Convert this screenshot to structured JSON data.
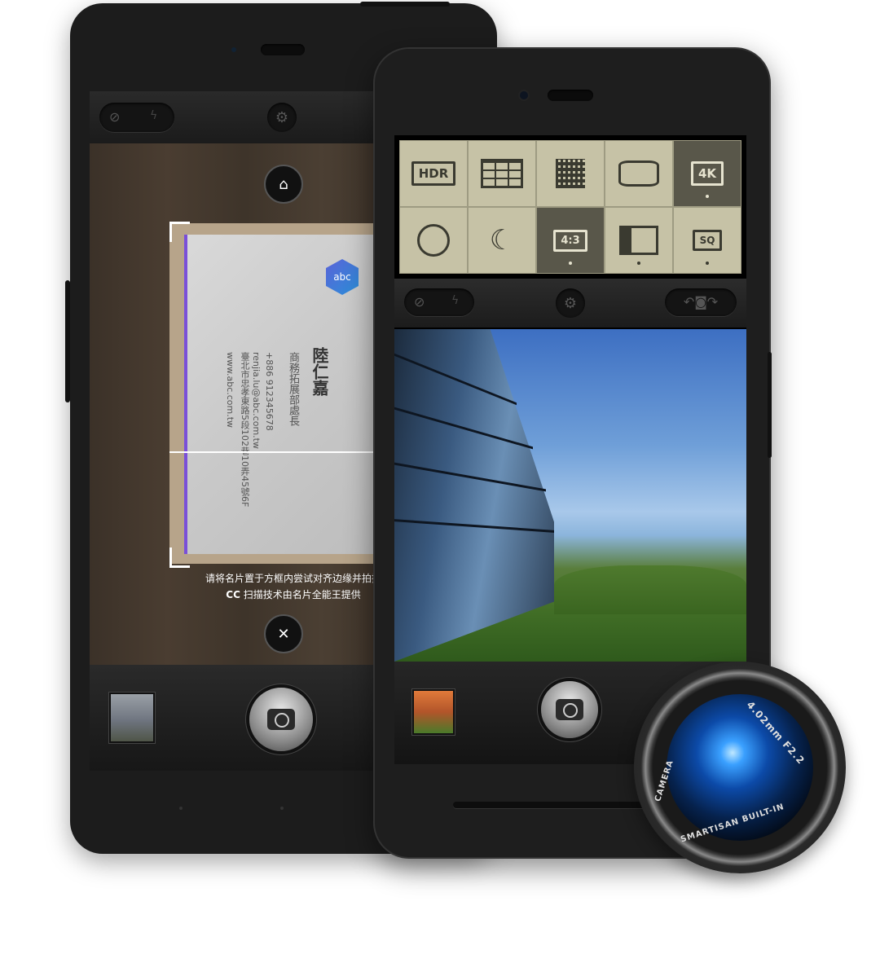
{
  "back_phone": {
    "flash_icon": "flashlight-icon",
    "toolbar": {
      "flash_toggle_icon": "flash-off-icon",
      "settings_icon": "gear-icon"
    },
    "card": {
      "logo_text": "abc",
      "name": "陸仁嘉",
      "title": "商務拓展部處長",
      "phone": "+886 912345678",
      "email": "renjia.lu@abc.com.tw",
      "address": "臺北市忠孝東路5段102巷10弄45號6F",
      "website": "www.abc.com.tw"
    },
    "hint_line1": "请将名片置于方框内尝试对齐边缘并拍摄",
    "hint_line2": "扫描技术由名片全能王提供",
    "hint_logo": "CC",
    "close_icon": "close-icon",
    "shutter_icon": "camera-icon"
  },
  "front_phone": {
    "modes": [
      {
        "label": "HDR",
        "icon": "hdr-icon",
        "active": false
      },
      {
        "label": "",
        "icon": "grid-icon",
        "active": false
      },
      {
        "label": "",
        "icon": "qr-code-icon",
        "active": false
      },
      {
        "label": "",
        "icon": "panorama-icon",
        "active": false
      },
      {
        "label": "4K",
        "icon": "4k-video-icon",
        "active": true
      },
      {
        "label": "",
        "icon": "timer-icon",
        "active": false
      },
      {
        "label": "",
        "icon": "night-mode-icon",
        "active": false
      },
      {
        "label": "4:3",
        "icon": "aspect-ratio-icon",
        "active": true
      },
      {
        "label": "",
        "icon": "id-card-icon",
        "active": true
      },
      {
        "label": "SQ",
        "icon": "square-photo-icon",
        "active": true
      }
    ],
    "toolbar": {
      "flash_toggle_icon": "flash-off-icon",
      "settings_icon": "gear-icon",
      "switch_camera_icon": "switch-camera-icon"
    },
    "shutter_icon": "camera-icon"
  },
  "lens": {
    "text_top": "4.02mm F2.2",
    "text_left": "CAMERA",
    "text_bottom": "SMARTISAN BUILT-IN"
  }
}
